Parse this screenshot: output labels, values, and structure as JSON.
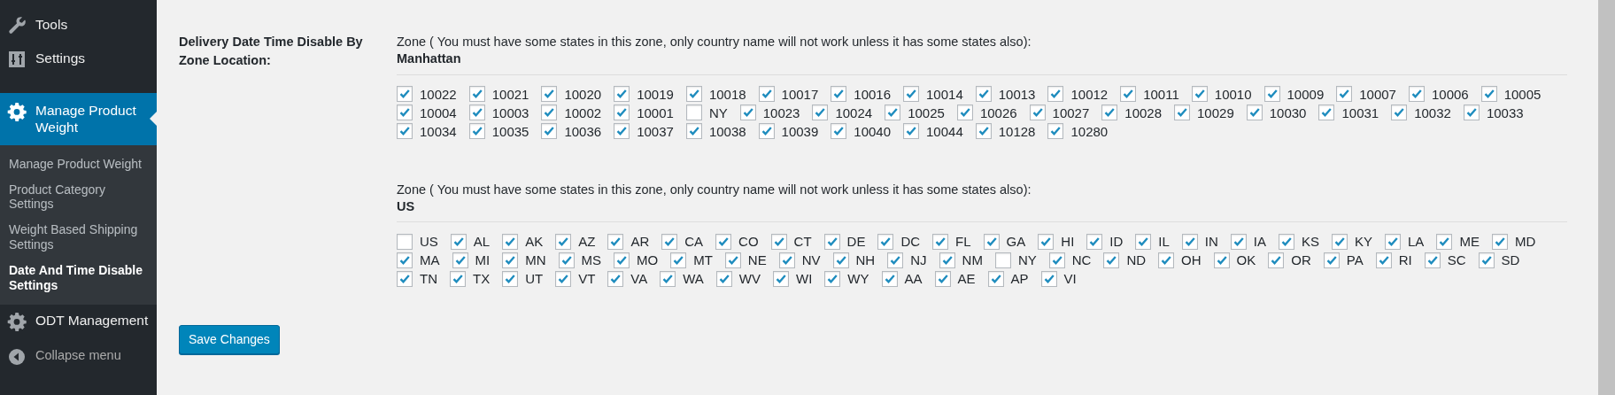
{
  "sidebar": {
    "items": [
      {
        "label": "Tools",
        "selected": false
      },
      {
        "label": "Settings",
        "selected": false
      },
      {
        "label": "Manage Product Weight",
        "selected": true,
        "children": [
          {
            "label": "Manage Product Weight",
            "selected": false
          },
          {
            "label": "Product Category Settings",
            "selected": false
          },
          {
            "label": "Weight Based Shipping Settings",
            "selected": false
          },
          {
            "label": "Date And Time Disable Settings",
            "selected": true
          }
        ]
      },
      {
        "label": "ODT Management",
        "selected": false
      }
    ],
    "collapse": {
      "label": "Collapse menu"
    }
  },
  "form": {
    "field_label": "Delivery Date Time Disable By Zone Location:",
    "zones": [
      {
        "note": "Zone ( You must have some states in this zone, only country name will not work unless it has some states also):",
        "name": "Manhattan",
        "options": [
          {
            "label": "10022",
            "checked": true
          },
          {
            "label": "10021",
            "checked": true
          },
          {
            "label": "10020",
            "checked": true
          },
          {
            "label": "10019",
            "checked": true
          },
          {
            "label": "10018",
            "checked": true
          },
          {
            "label": "10017",
            "checked": true
          },
          {
            "label": "10016",
            "checked": true
          },
          {
            "label": "10014",
            "checked": true
          },
          {
            "label": "10013",
            "checked": true
          },
          {
            "label": "10012",
            "checked": true
          },
          {
            "label": "10011",
            "checked": true
          },
          {
            "label": "10010",
            "checked": true
          },
          {
            "label": "10009",
            "checked": true
          },
          {
            "label": "10007",
            "checked": true
          },
          {
            "label": "10006",
            "checked": true
          },
          {
            "label": "10005",
            "checked": true
          },
          {
            "label": "10004",
            "checked": true
          },
          {
            "label": "10003",
            "checked": true
          },
          {
            "label": "10002",
            "checked": true
          },
          {
            "label": "10001",
            "checked": true
          },
          {
            "label": "NY",
            "checked": false
          },
          {
            "label": "10023",
            "checked": true
          },
          {
            "label": "10024",
            "checked": true
          },
          {
            "label": "10025",
            "checked": true
          },
          {
            "label": "10026",
            "checked": true
          },
          {
            "label": "10027",
            "checked": true
          },
          {
            "label": "10028",
            "checked": true
          },
          {
            "label": "10029",
            "checked": true
          },
          {
            "label": "10030",
            "checked": true
          },
          {
            "label": "10031",
            "checked": true
          },
          {
            "label": "10032",
            "checked": true
          },
          {
            "label": "10033",
            "checked": true
          },
          {
            "label": "10034",
            "checked": true
          },
          {
            "label": "10035",
            "checked": true
          },
          {
            "label": "10036",
            "checked": true
          },
          {
            "label": "10037",
            "checked": true
          },
          {
            "label": "10038",
            "checked": true
          },
          {
            "label": "10039",
            "checked": true
          },
          {
            "label": "10040",
            "checked": true
          },
          {
            "label": "10044",
            "checked": true
          },
          {
            "label": "10128",
            "checked": true
          },
          {
            "label": "10280",
            "checked": true
          }
        ]
      },
      {
        "note": "Zone ( You must have some states in this zone, only country name will not work unless it has some states also):",
        "name": "US",
        "options": [
          {
            "label": "US",
            "checked": false
          },
          {
            "label": "AL",
            "checked": true
          },
          {
            "label": "AK",
            "checked": true
          },
          {
            "label": "AZ",
            "checked": true
          },
          {
            "label": "AR",
            "checked": true
          },
          {
            "label": "CA",
            "checked": true
          },
          {
            "label": "CO",
            "checked": true
          },
          {
            "label": "CT",
            "checked": true
          },
          {
            "label": "DE",
            "checked": true
          },
          {
            "label": "DC",
            "checked": true
          },
          {
            "label": "FL",
            "checked": true
          },
          {
            "label": "GA",
            "checked": true
          },
          {
            "label": "HI",
            "checked": true
          },
          {
            "label": "ID",
            "checked": true
          },
          {
            "label": "IL",
            "checked": true
          },
          {
            "label": "IN",
            "checked": true
          },
          {
            "label": "IA",
            "checked": true
          },
          {
            "label": "KS",
            "checked": true
          },
          {
            "label": "KY",
            "checked": true
          },
          {
            "label": "LA",
            "checked": true
          },
          {
            "label": "ME",
            "checked": true
          },
          {
            "label": "MD",
            "checked": true
          },
          {
            "label": "MA",
            "checked": true
          },
          {
            "label": "MI",
            "checked": true
          },
          {
            "label": "MN",
            "checked": true
          },
          {
            "label": "MS",
            "checked": true
          },
          {
            "label": "MO",
            "checked": true
          },
          {
            "label": "MT",
            "checked": true
          },
          {
            "label": "NE",
            "checked": true
          },
          {
            "label": "NV",
            "checked": true
          },
          {
            "label": "NH",
            "checked": true
          },
          {
            "label": "NJ",
            "checked": true
          },
          {
            "label": "NM",
            "checked": true
          },
          {
            "label": "NY",
            "checked": false
          },
          {
            "label": "NC",
            "checked": true
          },
          {
            "label": "ND",
            "checked": true
          },
          {
            "label": "OH",
            "checked": true
          },
          {
            "label": "OK",
            "checked": true
          },
          {
            "label": "OR",
            "checked": true
          },
          {
            "label": "PA",
            "checked": true
          },
          {
            "label": "RI",
            "checked": true
          },
          {
            "label": "SC",
            "checked": true
          },
          {
            "label": "SD",
            "checked": true
          },
          {
            "label": "TN",
            "checked": true
          },
          {
            "label": "TX",
            "checked": true
          },
          {
            "label": "UT",
            "checked": true
          },
          {
            "label": "VT",
            "checked": true
          },
          {
            "label": "VA",
            "checked": true
          },
          {
            "label": "WA",
            "checked": true
          },
          {
            "label": "WV",
            "checked": true
          },
          {
            "label": "WI",
            "checked": true
          },
          {
            "label": "WY",
            "checked": true
          },
          {
            "label": "AA",
            "checked": true
          },
          {
            "label": "AE",
            "checked": true
          },
          {
            "label": "AP",
            "checked": true
          },
          {
            "label": "VI",
            "checked": true
          }
        ]
      }
    ],
    "save_button": "Save Changes"
  }
}
